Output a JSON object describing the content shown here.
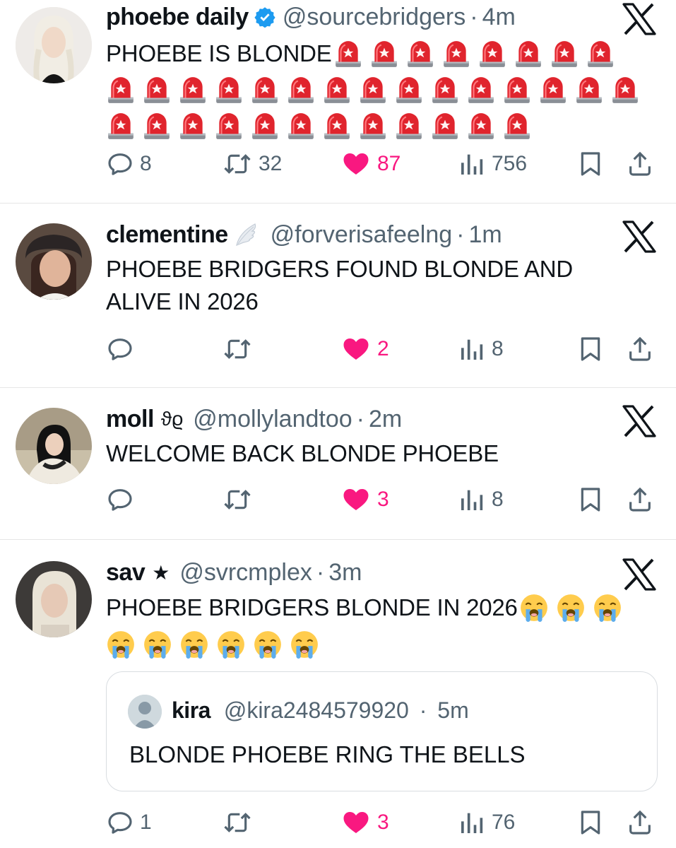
{
  "tweets": [
    {
      "name": "phoebe daily",
      "handle": "@sourcebridgers",
      "time": "4m",
      "text": "PHOEBE IS BLONDE",
      "replies": "8",
      "retweets": "32",
      "likes": "87",
      "views": "756"
    },
    {
      "name": "clementine",
      "handle": "@forverisafeelng",
      "time": "1m",
      "text_line1": "PHOEBE BRIDGERS FOUND BLONDE AND",
      "text_line2": "ALIVE IN 2026",
      "replies": "",
      "retweets": "",
      "likes": "2",
      "views": "8"
    },
    {
      "name": "moll",
      "name_suffix": "ϑϱ",
      "handle": "@mollylandtoo",
      "time": "2m",
      "text": "WELCOME BACK BLONDE PHOEBE",
      "replies": "",
      "retweets": "",
      "likes": "3",
      "views": "8"
    },
    {
      "name": "sav",
      "name_suffix": "★",
      "handle": "@svrcmplex",
      "time": "3m",
      "text": "PHOEBE BRIDGERS BLONDE IN 2026",
      "replies": "1",
      "retweets": "",
      "likes": "3",
      "views": "76",
      "quote": {
        "name": "kira",
        "handle": "@kira2484579920",
        "time": "5m",
        "text": "BLONDE PHOEBE RING THE BELLS"
      }
    }
  ],
  "separator": "·",
  "colors": {
    "like": "#f91880",
    "muted": "#536471",
    "verified": "#1d9bf0"
  },
  "icons": [
    "reply-icon",
    "retweet-icon",
    "like-icon",
    "views-icon",
    "bookmark-icon",
    "share-icon",
    "x-logo-icon",
    "verified-badge-icon"
  ]
}
